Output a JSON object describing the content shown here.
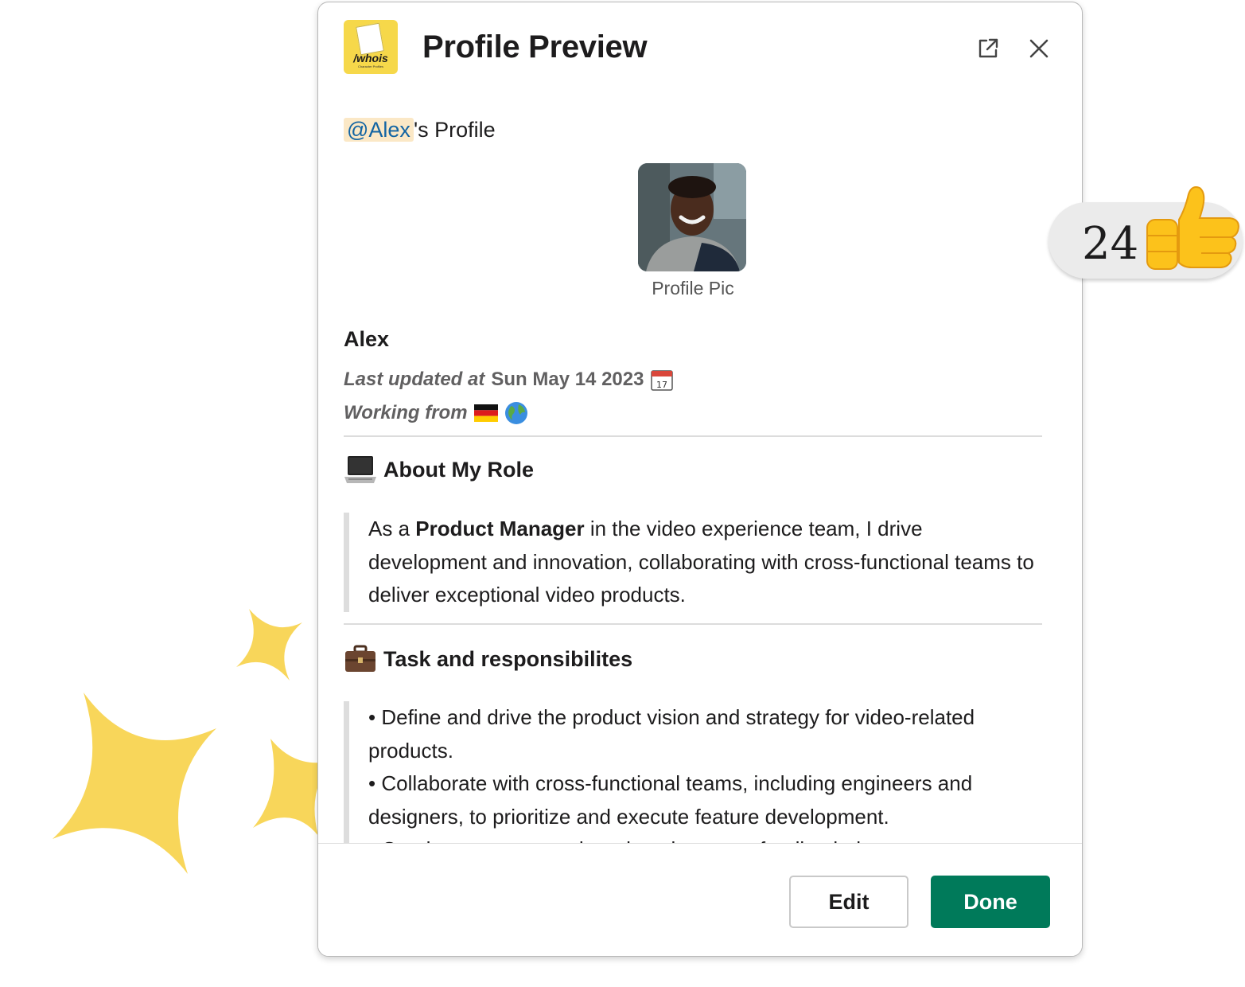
{
  "header": {
    "app_logo_text": "/whois",
    "app_logo_subtext": "Character Profiles",
    "title": "Profile Preview"
  },
  "profile": {
    "mention": "@Alex",
    "mention_suffix": "'s Profile",
    "pic_caption": "Profile Pic",
    "name": "Alex",
    "last_updated_label": "Last updated at",
    "last_updated_value": "Sun May 14 2023",
    "working_from_label": "Working from"
  },
  "sections": [
    {
      "title": "About My Role",
      "icon": "laptop-icon",
      "text_before": "As a ",
      "bold": "Product Manager",
      "text_after": " in the video experience team, I drive development and innovation, collaborating with cross-functional teams to deliver exceptional video products."
    },
    {
      "title": "Task and responsibilites",
      "icon": "briefcase-icon",
      "items": [
        "• Define and drive the product vision and strategy for video-related products.",
        "• Collaborate with cross-functional teams, including engineers and designers, to prioritize and execute feature development.",
        "• Conduct user research and analyze user feedback data"
      ]
    }
  ],
  "footer": {
    "edit_label": "Edit",
    "done_label": "Done"
  },
  "reaction": {
    "count": "24",
    "icon": "thumbs-up-icon"
  },
  "colors": {
    "accent_green": "#007a5a",
    "mention_bg": "#fbe8c6",
    "mention_text": "#1264a3",
    "sparkle": "#f8d65a"
  }
}
